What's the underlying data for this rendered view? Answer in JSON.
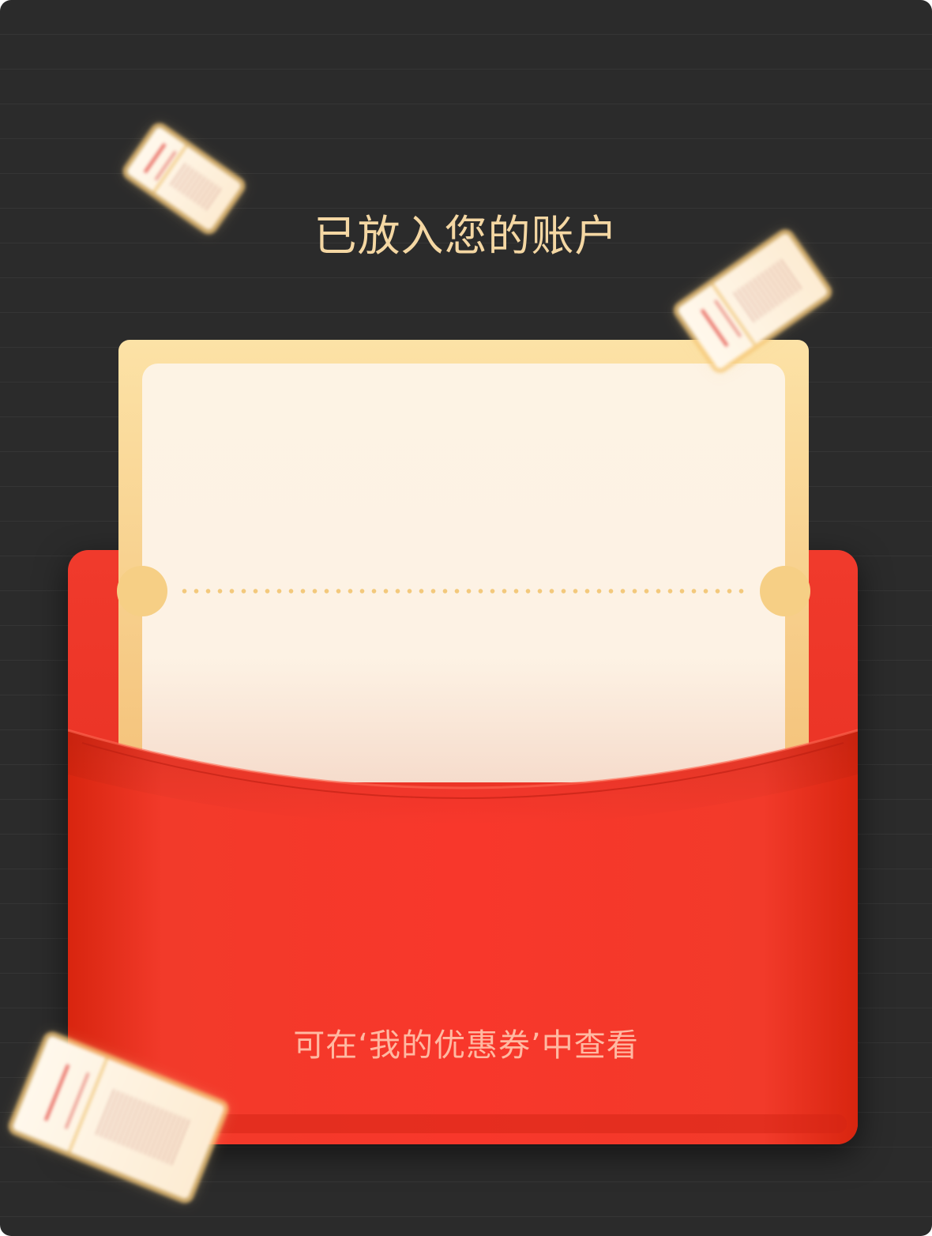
{
  "dialog": {
    "title": "已放入您的账户",
    "hint": "可在‘我的优惠券’中查看"
  },
  "colors": {
    "background": "#2b2b2b",
    "title": "#f4d7a3",
    "envelope": "#f03a2c",
    "coupon_border": "#f6cf85",
    "coupon_body": "#fdf3e4",
    "hint": "#ffb9a2"
  },
  "icons": {
    "flying_coupon": "coupon-icon"
  }
}
